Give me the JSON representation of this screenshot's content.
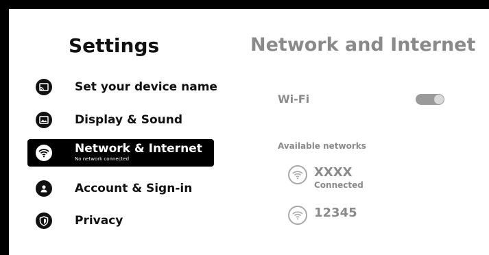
{
  "sidebar": {
    "title": "Settings",
    "items": [
      {
        "label": "Set your device name",
        "icon": "cast-icon"
      },
      {
        "label": "Display & Sound",
        "icon": "image-icon"
      },
      {
        "label": "Network & Internet",
        "sub": "No network connected",
        "icon": "wifi-icon",
        "active": true
      },
      {
        "label": "Account & Sign-in",
        "icon": "person-icon"
      },
      {
        "label": "Privacy",
        "icon": "shield-icon"
      }
    ]
  },
  "main": {
    "title": "Network and Internet",
    "wifi_label": "Wi-Fi",
    "wifi_enabled": true,
    "available_label": "Available networks",
    "networks": [
      {
        "name": "XXXX",
        "status": "Connected"
      },
      {
        "name": "12345"
      }
    ]
  },
  "colors": {
    "frame": "#000000",
    "active_bg": "#000000",
    "muted_text": "#8a8a8a",
    "toggle": "#9a9a9a"
  }
}
